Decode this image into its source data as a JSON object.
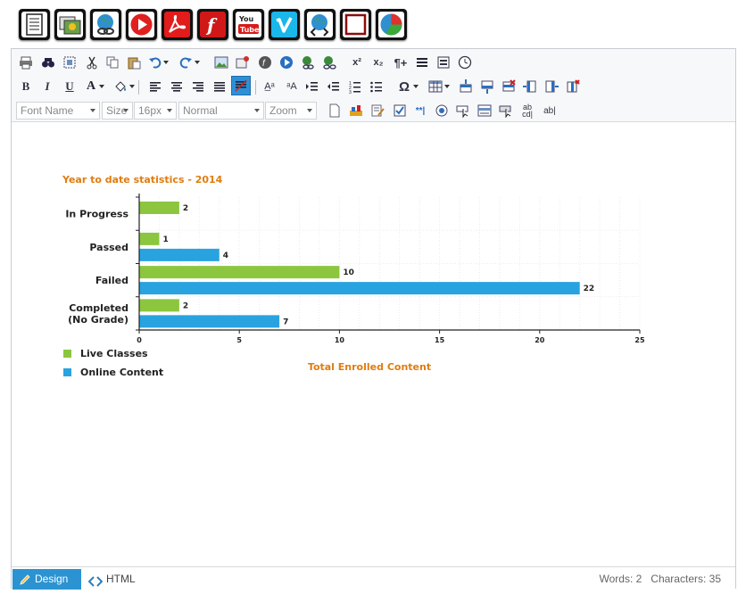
{
  "top_toolbar": {
    "buttons": [
      {
        "name": "document-icon",
        "label": ""
      },
      {
        "name": "image-gallery-icon",
        "label": ""
      },
      {
        "name": "globe-link-icon",
        "label": ""
      },
      {
        "name": "media-play-icon",
        "label": ""
      },
      {
        "name": "pdf-icon",
        "label": ""
      },
      {
        "name": "flash-icon",
        "label": ""
      },
      {
        "name": "youtube-icon",
        "label": "You Tube"
      },
      {
        "name": "vimeo-icon",
        "label": "V"
      },
      {
        "name": "globe-code-icon",
        "label": ""
      },
      {
        "name": "frame-icon",
        "label": ""
      },
      {
        "name": "pie-chart-icon",
        "label": ""
      }
    ]
  },
  "toolbar": {
    "font_name": "Font Name",
    "size": "Size",
    "font_px": "16px",
    "paragraph": "Normal",
    "zoom": "Zoom"
  },
  "chart": {
    "title": "Year to date statistics  - 2014",
    "x_axis_title": "Total Enrolled Content"
  },
  "chart_data": {
    "type": "bar",
    "orientation": "horizontal",
    "title": "Year to date statistics  - 2014",
    "xlabel": "Total Enrolled Content",
    "ylabel": "",
    "categories": [
      "In Progress",
      "Passed",
      "Failed",
      "Completed\n(No Grade)"
    ],
    "series": [
      {
        "name": "Live Classes",
        "color": "#8cc63f",
        "values": [
          2,
          1,
          10,
          2
        ]
      },
      {
        "name": "Online Content",
        "color": "#29a3e0",
        "values": [
          null,
          4,
          22,
          7
        ]
      }
    ],
    "xlim": [
      0,
      25
    ],
    "xticks": [
      0,
      5,
      10,
      15,
      20,
      25
    ],
    "grid": true,
    "legend": "bottom-left"
  },
  "status": {
    "design_label": "Design",
    "html_label": "HTML",
    "counts": "Words: 2   Characters: 35"
  },
  "colors": {
    "accent": "#2b93d1",
    "title_orange": "#e07c10",
    "live_classes": "#8cc63f",
    "online_content": "#29a3e0"
  }
}
